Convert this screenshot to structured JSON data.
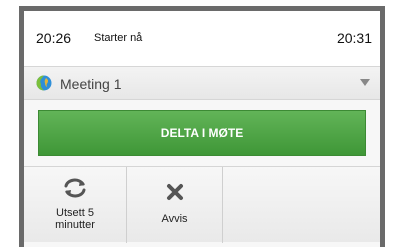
{
  "notification": {
    "start_time": "20:26",
    "status": "Starter nå",
    "end_time": "20:31",
    "meeting_title": "Meeting 1",
    "join_label": "DELTA I MØTE",
    "snooze_label": "Utsett 5\nminutter",
    "dismiss_label": "Avvis",
    "icons": {
      "meeting": "globe-icon",
      "dropdown": "triangle-down-icon",
      "snooze": "refresh-icon",
      "dismiss": "close-icon"
    },
    "colors": {
      "join_button": "#4ca544",
      "header_background": "#ffffff",
      "frame": "#6a6a6a"
    }
  }
}
